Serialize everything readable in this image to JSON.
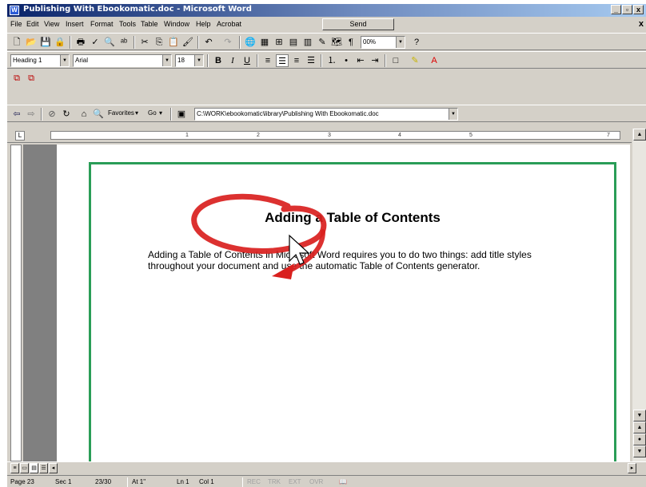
{
  "window": {
    "title": "Publishing With Ebookomatic.doc - Microsoft Word",
    "controls": [
      "_",
      "▫",
      "x"
    ],
    "doc_close": "x"
  },
  "menubar": {
    "items": [
      "File",
      "Edit",
      "View",
      "Insert",
      "Format",
      "Tools",
      "Table",
      "Window",
      "Help",
      "Acrobat"
    ],
    "send_label": "Send"
  },
  "standard_toolbar": {
    "zoom": "00%"
  },
  "formatting_toolbar": {
    "style": "Heading 1",
    "font": "Arial",
    "size": "18",
    "bold": "B",
    "italic": "I",
    "underline": "U"
  },
  "web_toolbar": {
    "favorites_label": "Favorites",
    "go_label": "Go",
    "address": "C:\\WORK\\ebookomatic\\library\\Publishing With Ebookomatic.doc"
  },
  "ruler": {
    "marks": [
      "1",
      "2",
      "3",
      "4",
      "5",
      "7"
    ]
  },
  "document": {
    "heading": "Adding a Table of Contents",
    "body": "Adding a Table of Contents in Microsoft Word requires you to do two things: add title styles throughout your document and use the automatic Table of Contents generator."
  },
  "status": {
    "page": "Page 23",
    "section": "Sec 1",
    "page_of": "23/30",
    "at": "At 1\"",
    "line": "Ln 1",
    "col": "Col 1",
    "rec": "REC",
    "trk": "TRK",
    "ext": "EXT",
    "ovr": "OVR"
  },
  "colors": {
    "title_bar": "#0a246a",
    "page_border": "#2a9d57",
    "annotation": "#d9201e"
  }
}
